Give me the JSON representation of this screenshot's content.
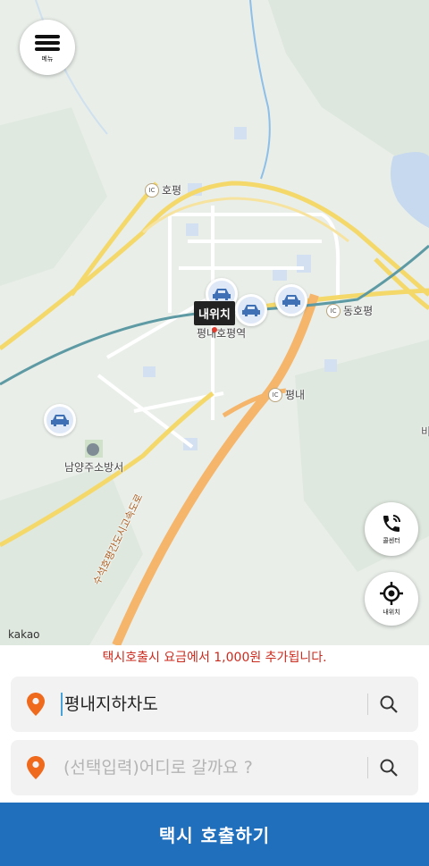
{
  "menu": {
    "label": "메뉴"
  },
  "map": {
    "location_pin_label": "내위치",
    "places": {
      "hopyeong_ic": "호평",
      "donghopyeong_ic": "동호평",
      "pyeongnae_ic": "평내",
      "station": "평내호평역",
      "fire_station": "남양주소방서",
      "expressway": "수석호평간도시고속도로",
      "edge_text": "비"
    },
    "ic_badge": "IC",
    "attribution": "kakao"
  },
  "call_center": {
    "label": "콜센터"
  },
  "my_location": {
    "label": "내위치"
  },
  "notice": "택시호출시 요금에서 1,000원 추가됩니다.",
  "origin": {
    "value": "평내지하차도"
  },
  "destination": {
    "placeholder": "(선택입력)어디로 갈까요 ?"
  },
  "call_button": {
    "label": "택시 호출하기"
  },
  "colors": {
    "accent": "#1f6fbd",
    "pin": "#f06a1d",
    "notice": "#cc2a1d"
  }
}
